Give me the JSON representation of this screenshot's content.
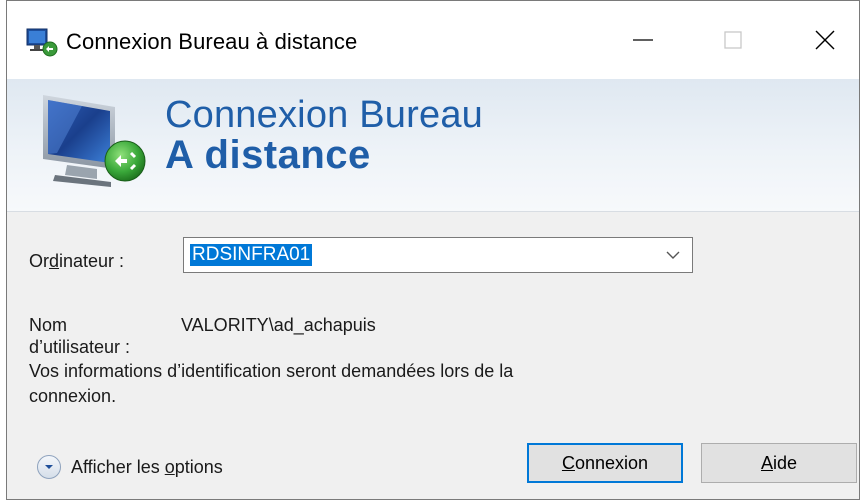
{
  "window": {
    "title": "Connexion Bureau à distance"
  },
  "banner": {
    "line1": "Connexion Bureau",
    "line2": "A distance"
  },
  "form": {
    "computer_label_pre": "Or",
    "computer_label_u": "d",
    "computer_label_post": "inateur :",
    "computer_value": "RDSINFRA01",
    "username_label_1": "Nom",
    "username_label_2": "d’utilisateur :",
    "username_value": "VALORITY\\ad_achapuis",
    "info_line1": "Vos informations d’identification seront demandées lors de la",
    "info_line2": "connexion."
  },
  "footer": {
    "options_pre": "Afficher les ",
    "options_u": "o",
    "options_post": "ptions",
    "connect_u": "C",
    "connect_post": "onnexion",
    "help_u": "A",
    "help_post": "ide"
  },
  "icons": {
    "app": "remote-desktop-icon",
    "minimize": "minimize-icon",
    "maximize": "maximize-icon",
    "close": "close-icon",
    "dropdown": "chevron-down-icon",
    "options": "expand-circle-icon"
  },
  "colors": {
    "accent": "#0078d7",
    "brand_text": "#1f5ea8"
  }
}
